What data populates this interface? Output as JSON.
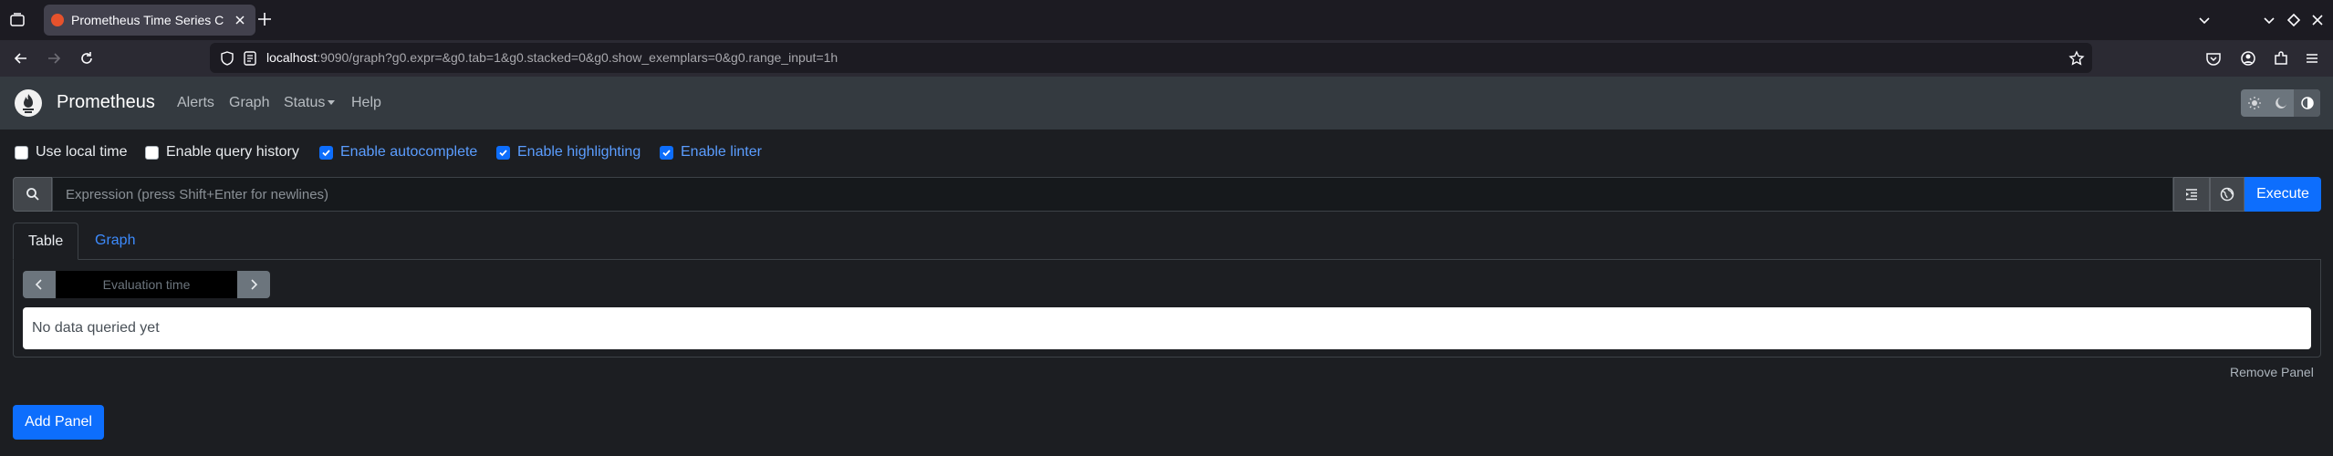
{
  "browser": {
    "tab_title": "Prometheus Time Series C",
    "url_host": "localhost",
    "url_rest": ":9090/graph?g0.expr=&g0.tab=1&g0.stacked=0&g0.show_exemplars=0&g0.range_input=1h"
  },
  "navbar": {
    "brand": "Prometheus",
    "links": [
      "Alerts",
      "Graph",
      "Status",
      "Help"
    ]
  },
  "options": [
    {
      "label": "Use local time",
      "checked": false
    },
    {
      "label": "Enable query history",
      "checked": false
    },
    {
      "label": "Enable autocomplete",
      "checked": true
    },
    {
      "label": "Enable highlighting",
      "checked": true
    },
    {
      "label": "Enable linter",
      "checked": true
    }
  ],
  "expression": {
    "placeholder": "Expression (press Shift+Enter for newlines)",
    "execute_label": "Execute"
  },
  "panel": {
    "tabs": [
      "Table",
      "Graph"
    ],
    "active_tab": "Table",
    "eval_placeholder": "Evaluation time",
    "empty_message": "No data queried yet",
    "remove_label": "Remove Panel"
  },
  "add_panel_label": "Add Panel",
  "colors": {
    "accent": "#0d6efd",
    "navbar": "#343a40",
    "background": "#1c1e22"
  }
}
